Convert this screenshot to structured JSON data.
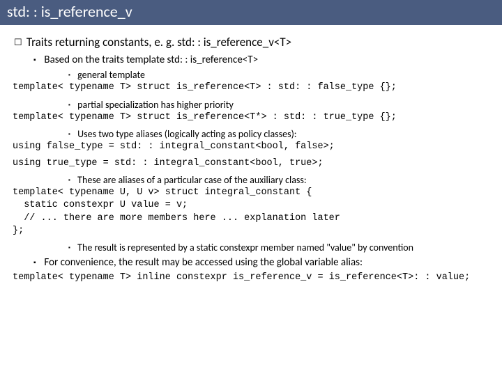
{
  "title": "std: : is_reference_v",
  "h1": "Traits returning constants, e. g. std: : is_reference_v<T>",
  "h2a": "Based on the traits template std: : is_reference<T>",
  "b1": "general template",
  "c1": "template< typename T> struct is_reference<T> : std: : false_type {};",
  "b2": "partial specialization has higher priority",
  "c2": "template< typename T> struct is_reference<T*> : std: : true_type {};",
  "b3": "Uses two type aliases (logically acting as policy classes):",
  "c3": "using false_type = std: : integral_constant<bool, false>;",
  "c4": "using true_type = std: : integral_constant<bool, true>;",
  "b4": "These are aliases of a particular case of the auxiliary class:",
  "c5": "template< typename U, U v> struct integral_constant {\n  static constexpr U value = v;\n  // ... there are more members here ... explanation later\n};",
  "b5": "The result is represented by a static constexpr member named \"value\" by convention",
  "h2b": "For convenience, the result may be accessed using the global variable alias:",
  "c6": "template< typename T> inline constexpr is_reference_v = is_reference<T>: : value;"
}
